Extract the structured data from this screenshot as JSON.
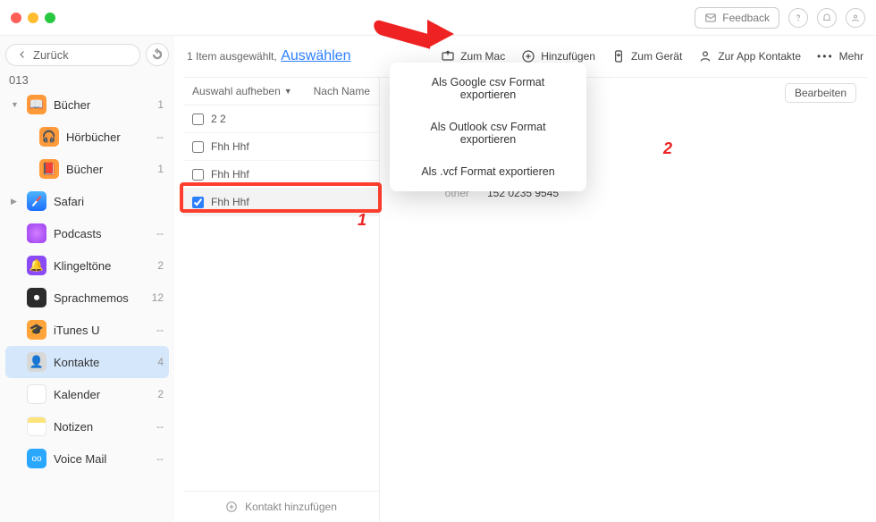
{
  "window": {
    "feedback": "Feedback"
  },
  "sidebar": {
    "back": "Zurück",
    "device": "013",
    "items": [
      {
        "label": "Bücher",
        "count": "1",
        "expandable": true
      },
      {
        "label": "Hörbücher",
        "count": "--"
      },
      {
        "label": "Bücher",
        "count": "1"
      },
      {
        "label": "Safari",
        "count": "",
        "expandable": true
      },
      {
        "label": "Podcasts",
        "count": "--"
      },
      {
        "label": "Klingeltöne",
        "count": "2"
      },
      {
        "label": "Sprachmemos",
        "count": "12"
      },
      {
        "label": "iTunes U",
        "count": "--"
      },
      {
        "label": "Kontakte",
        "count": "4",
        "active": true
      },
      {
        "label": "Kalender",
        "count": "2"
      },
      {
        "label": "Notizen",
        "count": "--"
      },
      {
        "label": "Voice Mail",
        "count": "--"
      }
    ]
  },
  "toolbar": {
    "selection_text": "1 Item ausgewählt,",
    "select_link": "Auswählen",
    "to_mac": "Zum Mac",
    "add": "Hinzufügen",
    "to_device": "Zum Gerät",
    "to_contacts": "Zur App Kontakte",
    "more": "Mehr"
  },
  "columns": {
    "deselect": "Auswahl aufheben",
    "by_name": "Nach Name"
  },
  "rows": [
    {
      "name": "2 2",
      "checked": false
    },
    {
      "name": "Fhh Hhf",
      "checked": false
    },
    {
      "name": "Fhh Hhf",
      "checked": false
    },
    {
      "name": "Fhh Hhf",
      "checked": true
    }
  ],
  "add_contact": "Kontakt hinzufügen",
  "detail": {
    "edit": "Bearbeiten",
    "field_key": "other",
    "field_val": "152 0235 9545"
  },
  "dropdown": {
    "items": [
      "Als Google csv Format exportieren",
      "Als Outlook csv Format exportieren",
      "Als .vcf Format exportieren"
    ]
  },
  "annotations": {
    "one": "1",
    "two": "2"
  }
}
